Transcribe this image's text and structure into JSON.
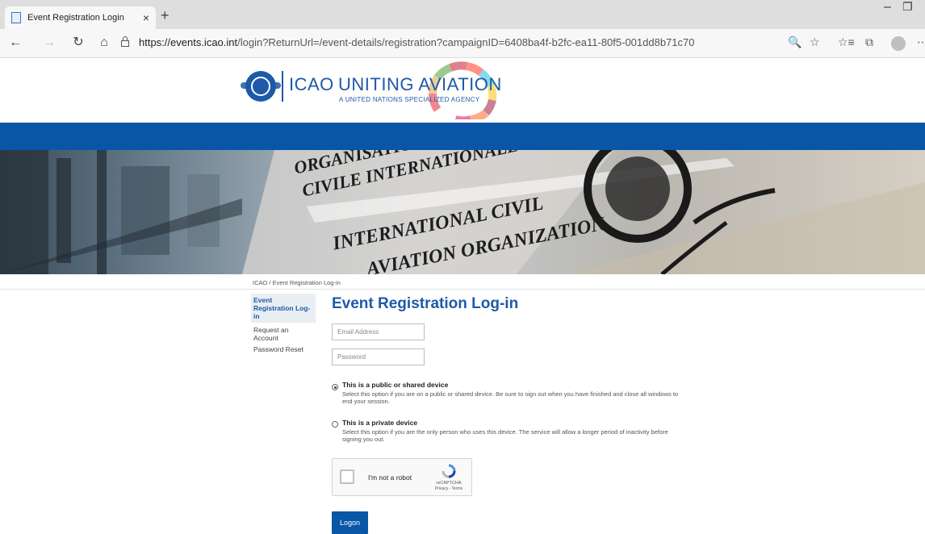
{
  "browser": {
    "tab_title": "Event Registration Login",
    "tab_close": "×",
    "new_tab": "+",
    "url_host": "https://events.icao.int",
    "url_path": "/login?ReturnUrl=/event-details/registration?campaignID=6408ba4f-b2fc-ea11-80f5-001dd8b71c70",
    "icons": {
      "back": "←",
      "forward": "→",
      "reload": "↻",
      "home": "⌂",
      "zoom": "🔍",
      "favorite": "☆",
      "favorites": "☆≡",
      "collections": "⧉",
      "more": "⋯",
      "minimize": "–",
      "maximize": "❐"
    }
  },
  "header": {
    "logo_icao": "ICAO",
    "logo_uniting": "UNITING AVIATION",
    "logo_tagline": "A UNITED NATIONS SPECIALIZED AGENCY",
    "brand_blue": "#0856a5"
  },
  "banner": {
    "line1": "ORGANISATION DE L'AVIATION",
    "line2": "CIVILE INTERNATIONALE",
    "line3": "INTERNATIONAL CIVIL",
    "line4": "AVIATION ORGANIZATION"
  },
  "breadcrumb": "ICAO / Event Registration Log-in",
  "side_nav": {
    "items": [
      {
        "label": "Event Registration Log-in",
        "active": true
      },
      {
        "label": "Request an Account",
        "active": false
      },
      {
        "label": "Password Reset",
        "active": false
      }
    ]
  },
  "form": {
    "title": "Event Registration Log-in",
    "email_placeholder": "Email Address",
    "password_placeholder": "Password",
    "public_option_title": "This is a public or shared device",
    "public_option_desc": "Select this option if you are on a public or shared device. Be sure to sign out when you have finished and close all windows to end your session.",
    "private_option_title": "This is a private device",
    "private_option_desc": "Select this option if you are the only person who uses this device. The service will allow a longer period of inactivity before signing you out.",
    "selected_option": "public",
    "logon_label": "Logon"
  },
  "captcha": {
    "label": "I'm not a robot",
    "brand": "reCAPTCHA",
    "links": "Privacy - Terms"
  }
}
